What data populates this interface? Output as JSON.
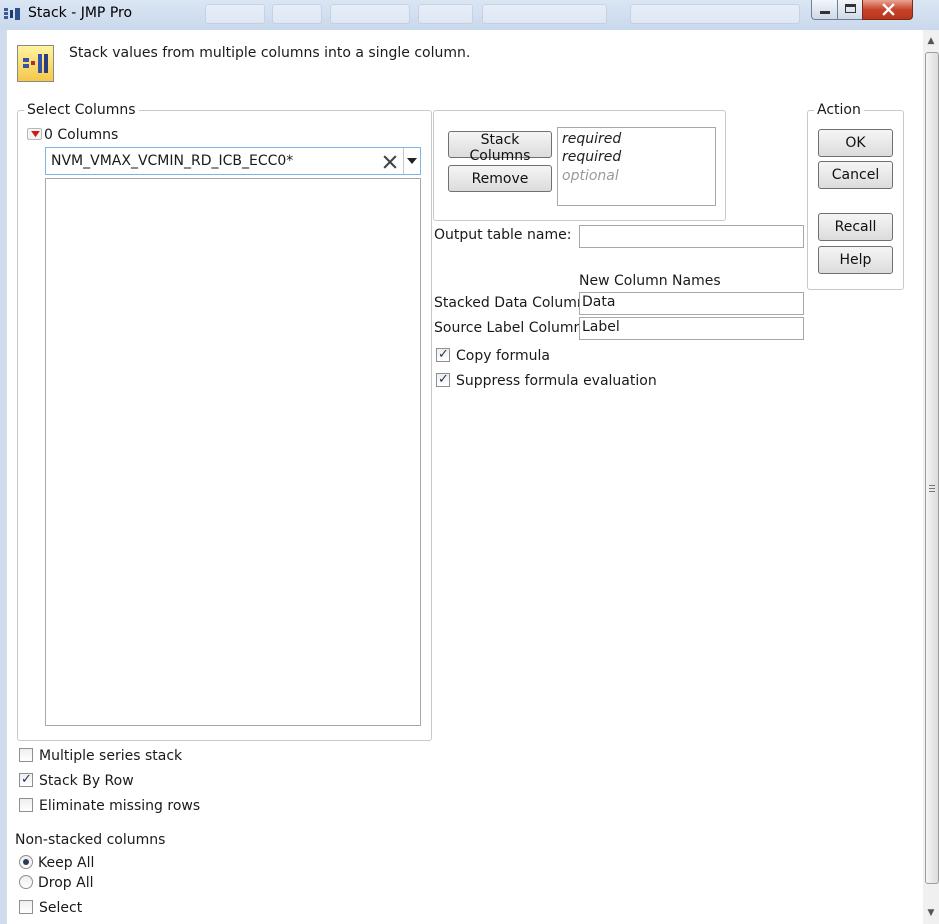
{
  "window": {
    "title": "Stack - JMP Pro"
  },
  "header": {
    "description": "Stack values from multiple columns into a single column.",
    "icon": "stack-columns-icon"
  },
  "select_columns": {
    "title": "Select Columns",
    "count_label": "0 Columns",
    "filter_value": "NVM_VMAX_VCMIN_RD_ICB_ECC0*"
  },
  "roles": {
    "stack_columns_label": "Stack Columns",
    "remove_label": "Remove",
    "slots": [
      "required",
      "required",
      "optional"
    ]
  },
  "output": {
    "table_name_label": "Output table name:",
    "table_name_value": "",
    "new_column_names_label": "New Column Names",
    "stacked_data_label": "Stacked Data Column",
    "stacked_data_value": "Data",
    "source_label_label": "Source Label Column",
    "source_label_value": "Label",
    "copy_formula_label": "Copy formula",
    "copy_formula_checked": true,
    "suppress_eval_label": "Suppress formula evaluation",
    "suppress_eval_checked": true
  },
  "action": {
    "title": "Action",
    "ok_label": "OK",
    "cancel_label": "Cancel",
    "recall_label": "Recall",
    "help_label": "Help"
  },
  "options": {
    "multiple_series_label": "Multiple series stack",
    "multiple_series_checked": false,
    "stack_by_row_label": "Stack By Row",
    "stack_by_row_checked": true,
    "eliminate_missing_label": "Eliminate missing rows",
    "eliminate_missing_checked": false
  },
  "non_stacked": {
    "title": "Non-stacked columns",
    "keep_all_label": "Keep All",
    "keep_all_selected": true,
    "drop_all_label": "Drop All",
    "drop_all_selected": false,
    "select_label": "Select",
    "select_checked": false
  },
  "colors": {
    "titlebar": "#c9d8ec",
    "group_border": "#c9c9c9",
    "dropdown_red": "#cc1a1a",
    "filter_border": "#7eb4ea"
  }
}
